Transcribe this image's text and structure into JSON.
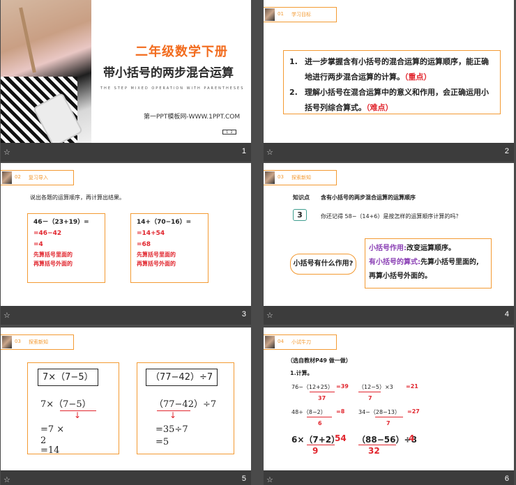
{
  "slides": [
    {
      "number": "1",
      "title": "二年级数学下册",
      "subtitle": "带小括号的两步混合运算",
      "english": "THE STEP MIXED OPERATION WITH PARENTHESES",
      "site": "第一PPT模板网-WWW.1PPT.COM",
      "tag": "1 · 2"
    },
    {
      "number": "2",
      "header": {
        "no": "01",
        "title": "学习目标"
      },
      "items": [
        {
          "idx": "1.",
          "text": "进一步掌握含有小括号的混合运算的运算顺序，能正确地进行两步混合运算的计算。",
          "mark": "（重点）"
        },
        {
          "idx": "2.",
          "text": "理解小括号在混合运算中的意义和作用，会正确运用小括号列综合算式。",
          "mark": "（难点）"
        }
      ]
    },
    {
      "number": "3",
      "header": {
        "no": "02",
        "title": "复习导入"
      },
      "intro": "说出各题的运算顺序，再计算出结果。",
      "left": {
        "expr": "46－（23+19）=",
        "step1": "=46−42",
        "step2": "=4",
        "note1": "先算括号里面的",
        "note2": "再算括号外面的"
      },
      "right": {
        "expr": "14+（70−16）=",
        "step1": "=14+54",
        "step2": "=68",
        "note1": "先算括号里面的",
        "note2": "再算括号外面的"
      }
    },
    {
      "number": "4",
      "header": {
        "no": "03",
        "title": "探索新知"
      },
      "kp_label": "知识点",
      "kp_text": "含有小括号的两步混合运算的运算顺序",
      "book": "3",
      "question": "你还记得 58−（14+6）是按怎样的运算顺序计算的吗？",
      "bubble": "小括号有什么作用?",
      "ans1_label": "小括号作用:",
      "ans1_text": "改变运算顺序。",
      "ans2_label": "有小括号的算式:",
      "ans2_text": "先算小括号里面的,",
      "ans3_text": "再算小括号外面的。"
    },
    {
      "number": "5",
      "header": {
        "no": "03",
        "title": "探索新知"
      },
      "left": {
        "head": "7×（7−5）",
        "expr": "7×（7−5）",
        "step1": "=7   ×",
        "step1b": "2",
        "step2": "=14"
      },
      "right": {
        "head": "（77−42）÷7",
        "expr": "（77−42）÷7",
        "step1": "=35÷7",
        "step2": "=5"
      }
    },
    {
      "number": "6",
      "header": {
        "no": "04",
        "title": "小试牛刀"
      },
      "source": "（选自教材P49 做一做）",
      "calc": "1.计算。",
      "rows": [
        {
          "e1": "76−（12+25）",
          "r1": "=39",
          "s1": "37",
          "e2": "（12−5）×3",
          "r2": "=21",
          "s2": "7"
        },
        {
          "e1": "48÷（8−2）",
          "r1": "=8",
          "s1": "6",
          "e2": "34−（28−13）",
          "r2": "=27",
          "s2": "7"
        }
      ],
      "big": {
        "e1": "6×（7+2）",
        "r1": "54",
        "s1": "9",
        "e2": "（88−56）÷8",
        "r2": "4",
        "s2": "32"
      }
    }
  ]
}
